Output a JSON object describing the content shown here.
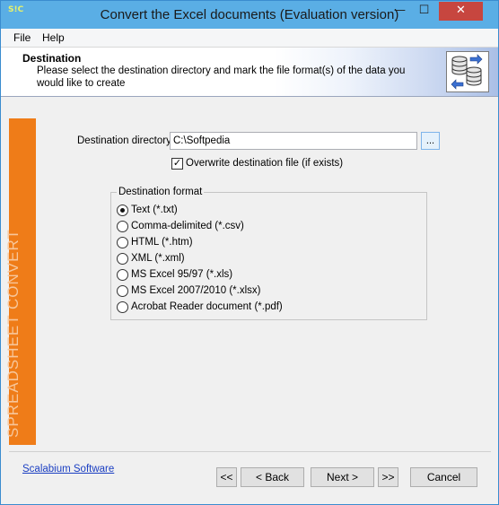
{
  "window": {
    "title": "Convert the Excel documents (Evaluation version)",
    "icon_text": "S!C",
    "minimize_glyph": "—",
    "maximize_glyph": "☐",
    "close_glyph": "✕"
  },
  "menu": {
    "items": [
      {
        "label": "File"
      },
      {
        "label": "Help"
      }
    ]
  },
  "header": {
    "title": "Destination",
    "description": "Please select the destination directory and mark the file format(s) of the data you would like to create",
    "icon": "database-convert-icon"
  },
  "banner": {
    "text": "SPREADSHEET CONVERT"
  },
  "destination": {
    "label": "Destination directory:",
    "value": "C:\\Softpedia",
    "browse_label": "...",
    "overwrite_label": "Overwrite destination file (if exists)",
    "overwrite_checked": true
  },
  "format": {
    "legend": "Destination format",
    "options": [
      {
        "label": "Text (*.txt)",
        "checked": true
      },
      {
        "label": "Comma-delimited (*.csv)",
        "checked": false
      },
      {
        "label": "HTML (*.htm)",
        "checked": false
      },
      {
        "label": "XML (*.xml)",
        "checked": false
      },
      {
        "label": "MS Excel 95/97 (*.xls)",
        "checked": false
      },
      {
        "label": "MS Excel 2007/2010 (*.xlsx)",
        "checked": false
      },
      {
        "label": "Acrobat Reader document (*.pdf)",
        "checked": false
      }
    ]
  },
  "footer": {
    "link": "Scalabium Software",
    "first_label": "<<",
    "back_label": "< Back",
    "next_label": "Next >",
    "last_label": ">>",
    "cancel_label": "Cancel"
  },
  "colors": {
    "title_bar": "#5aaee5",
    "banner": "#ef7c18",
    "close_button": "#c7463f",
    "link": "#1a3ec2"
  }
}
